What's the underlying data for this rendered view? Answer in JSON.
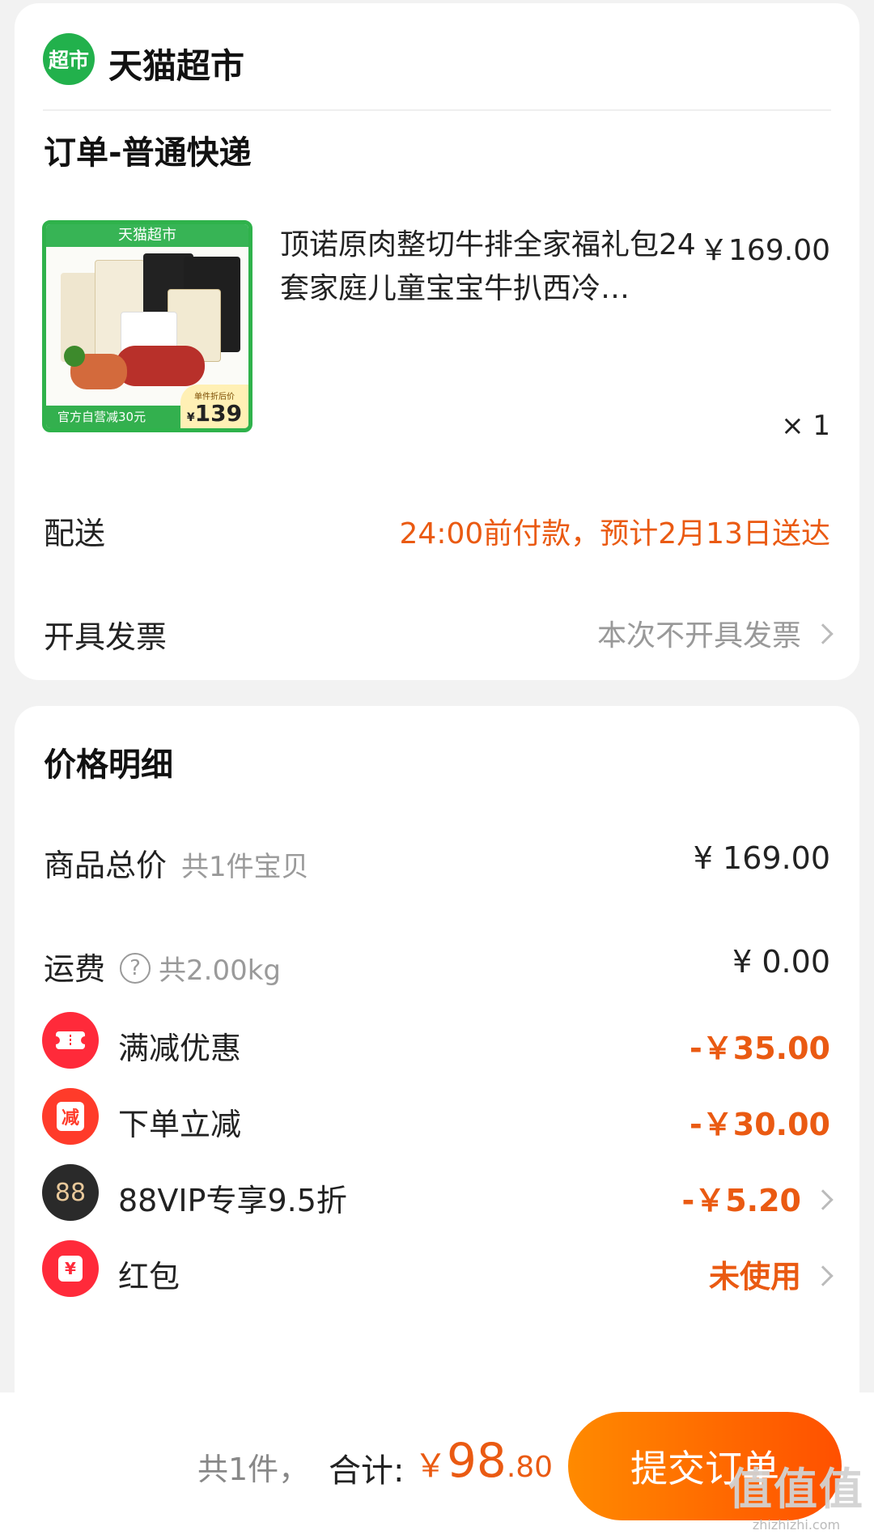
{
  "store": {
    "logo_text": "超市",
    "name": "天猫超市"
  },
  "order": {
    "title": "订单-普通快递",
    "product": {
      "image_banner": "天猫超市",
      "image_bottom_text": "官方自营减30元",
      "image_price_label": "单件折后价",
      "image_price_currency": "¥",
      "image_price_value": "139",
      "title": "顶诺原肉整切牛排全家福礼包24套家庭儿童宝宝牛扒西冷…",
      "price": "￥169.00",
      "qty": "× 1"
    },
    "delivery": {
      "label": "配送",
      "value": "24:00前付款，预计2月13日送达"
    },
    "invoice": {
      "label": "开具发票",
      "value": "本次不开具发票"
    }
  },
  "price_detail": {
    "title": "价格明细",
    "subtotal": {
      "label": "商品总价",
      "sub": "共1件宝贝",
      "value": "¥ 169.00"
    },
    "shipping": {
      "label": "运费",
      "help": "?",
      "sub": "共2.00kg",
      "value": "¥ 0.00"
    },
    "discounts": [
      {
        "icon": "coupon-icon",
        "label": "满减优惠",
        "value": "-￥35.00"
      },
      {
        "icon": "reduce-icon",
        "icon_text": "减",
        "label": "下单立减",
        "value": "-￥30.00"
      },
      {
        "icon": "vip88-icon",
        "icon_text": "88",
        "label": "88VIP专享9.5折",
        "value": "-￥5.20"
      },
      {
        "icon": "red-packet-icon",
        "icon_text": "¥",
        "label": "红包",
        "value": "未使用"
      }
    ]
  },
  "bottom_bar": {
    "count": "共1件，",
    "total_label": "合计:",
    "total_currency": "￥",
    "total_int": "98",
    "total_dec": ".80",
    "submit": "提交订单",
    "watermark_main": "值值值",
    "watermark_sub": "zhizhizhi.com"
  },
  "colors": {
    "accent": "#ea5a12",
    "brand_green": "#22b14c",
    "button": "#ff6a00"
  }
}
